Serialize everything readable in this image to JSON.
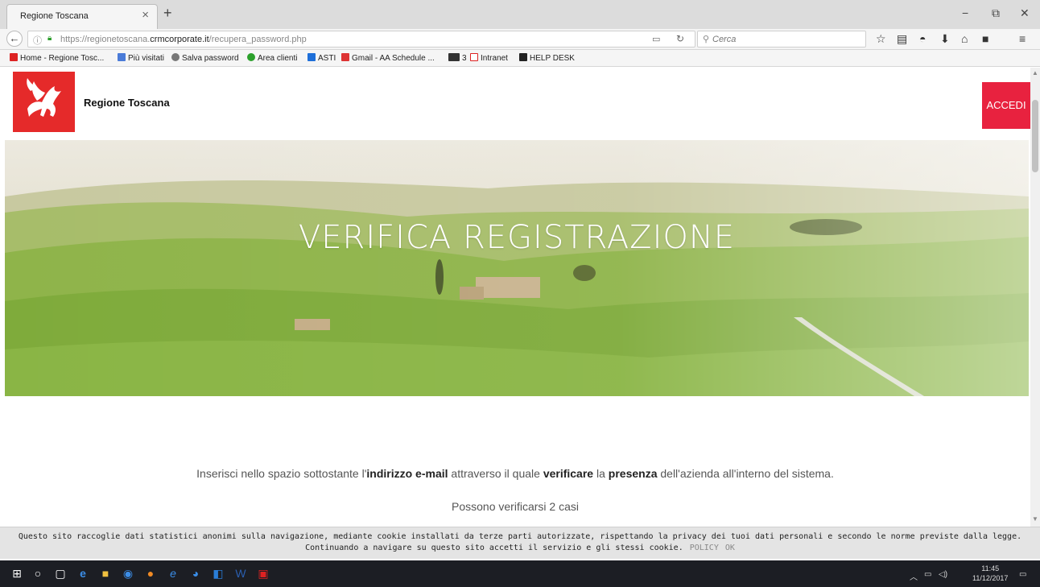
{
  "browser": {
    "tab_title": "Regione Toscana",
    "tab_close": "×",
    "new_tab": "+",
    "window_controls": {
      "minimize": "−",
      "restore": "⧉",
      "close": "✕"
    },
    "url_prefix": "https://regionetoscana.",
    "url_domain": "crmcorporate.it",
    "url_path": "/recupera_password.php",
    "search_placeholder": "Cerca",
    "icons": [
      "star-icon",
      "clipboard-icon",
      "pocket-icon",
      "download-icon",
      "home-icon",
      "pdf-icon",
      "menu-icon"
    ]
  },
  "bookmarks": [
    {
      "label": "Home - Regione Tosc...",
      "color": "#d22"
    },
    {
      "label": "Più visitati",
      "color": "#4a7bd8"
    },
    {
      "label": "Salva password",
      "color": "#777"
    },
    {
      "label": "Area clienti",
      "color": "#2ba02b"
    },
    {
      "label": "ASTI",
      "color": "#1e6fd9"
    },
    {
      "label": "Gmail - AA Schedule ...",
      "color": "#d33"
    },
    {
      "label": "3",
      "color": "#333"
    },
    {
      "label": "Intranet",
      "color": "#d22"
    },
    {
      "label": "HELP DESK",
      "color": "#222"
    }
  ],
  "site": {
    "brand": "Regione Toscana",
    "login_button": "ACCEDI",
    "hero_title": "VERIFICA REGISTRAZIONE",
    "intro": {
      "t1": "Inserisci nello spazio sottostante l'",
      "b1": "indirizzo e-mail",
      "t2": " attraverso il quale ",
      "b2": "verificare",
      "t3": " la ",
      "b3": "presenza",
      "t4": " dell'azienda all'interno del sistema."
    },
    "cases": "Possono verificarsi 2 casi",
    "accent_color": "#e8223f"
  },
  "cookie": {
    "line1": "Questo sito raccoglie dati statistici anonimi sulla navigazione, mediante cookie installati da terze parti autorizzate, rispettando la privacy dei tuoi dati personali e secondo le norme previste dalla legge.",
    "line2": "Continuando a navigare su questo sito accetti il servizio e gli stessi cookie.",
    "policy": "POLICY",
    "ok": "OK"
  },
  "taskbar": {
    "time": "11:45",
    "date": "11/12/2017"
  }
}
